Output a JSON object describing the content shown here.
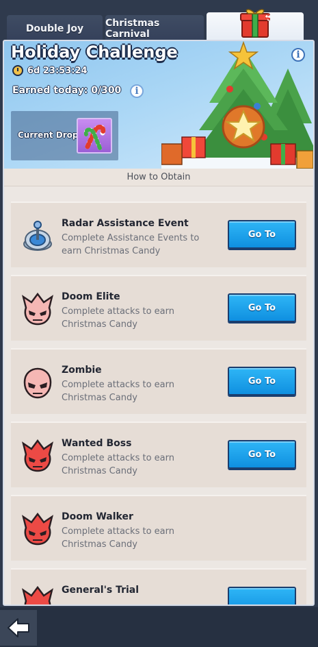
{
  "tabs": [
    {
      "label": "Double Joy"
    },
    {
      "label": "Christmas Carnival"
    },
    {
      "label": ""
    }
  ],
  "banner": {
    "title": "Holiday Challenge",
    "timer": "6d 23:53:24",
    "earned_today": "Earned today: 0/300",
    "current_drop_label": "Current Drop:",
    "info_icon": "i"
  },
  "how_to_obtain": "How to Obtain",
  "tasks": [
    {
      "title": "Radar Assistance Event",
      "description": "Complete Assistance Events to earn Christmas Candy",
      "button": "Go To",
      "icon": "radar-icon"
    },
    {
      "title": "Doom Elite",
      "description": "Complete attacks to earn Christmas Candy",
      "button": "Go To",
      "icon": "skull-spiked-icon"
    },
    {
      "title": "Zombie",
      "description": "Complete attacks to earn Christmas Candy",
      "button": "Go To",
      "icon": "skull-icon"
    },
    {
      "title": "Wanted Boss",
      "description": "Complete attacks to earn Christmas Candy",
      "button": "Go To",
      "icon": "red-skull-spiked-icon"
    },
    {
      "title": "Doom Walker",
      "description": "Complete attacks to earn Christmas Candy",
      "button": "Go To",
      "icon": "red-skull-spiked-icon"
    },
    {
      "title": "General's Trial",
      "description": "",
      "button": "",
      "icon": "red-skull-spiked-icon"
    }
  ],
  "colors": {
    "accent_blue": "#1aa3ec",
    "banner_sky": "#a9d6f5",
    "card_bg": "#e6ddd6"
  }
}
